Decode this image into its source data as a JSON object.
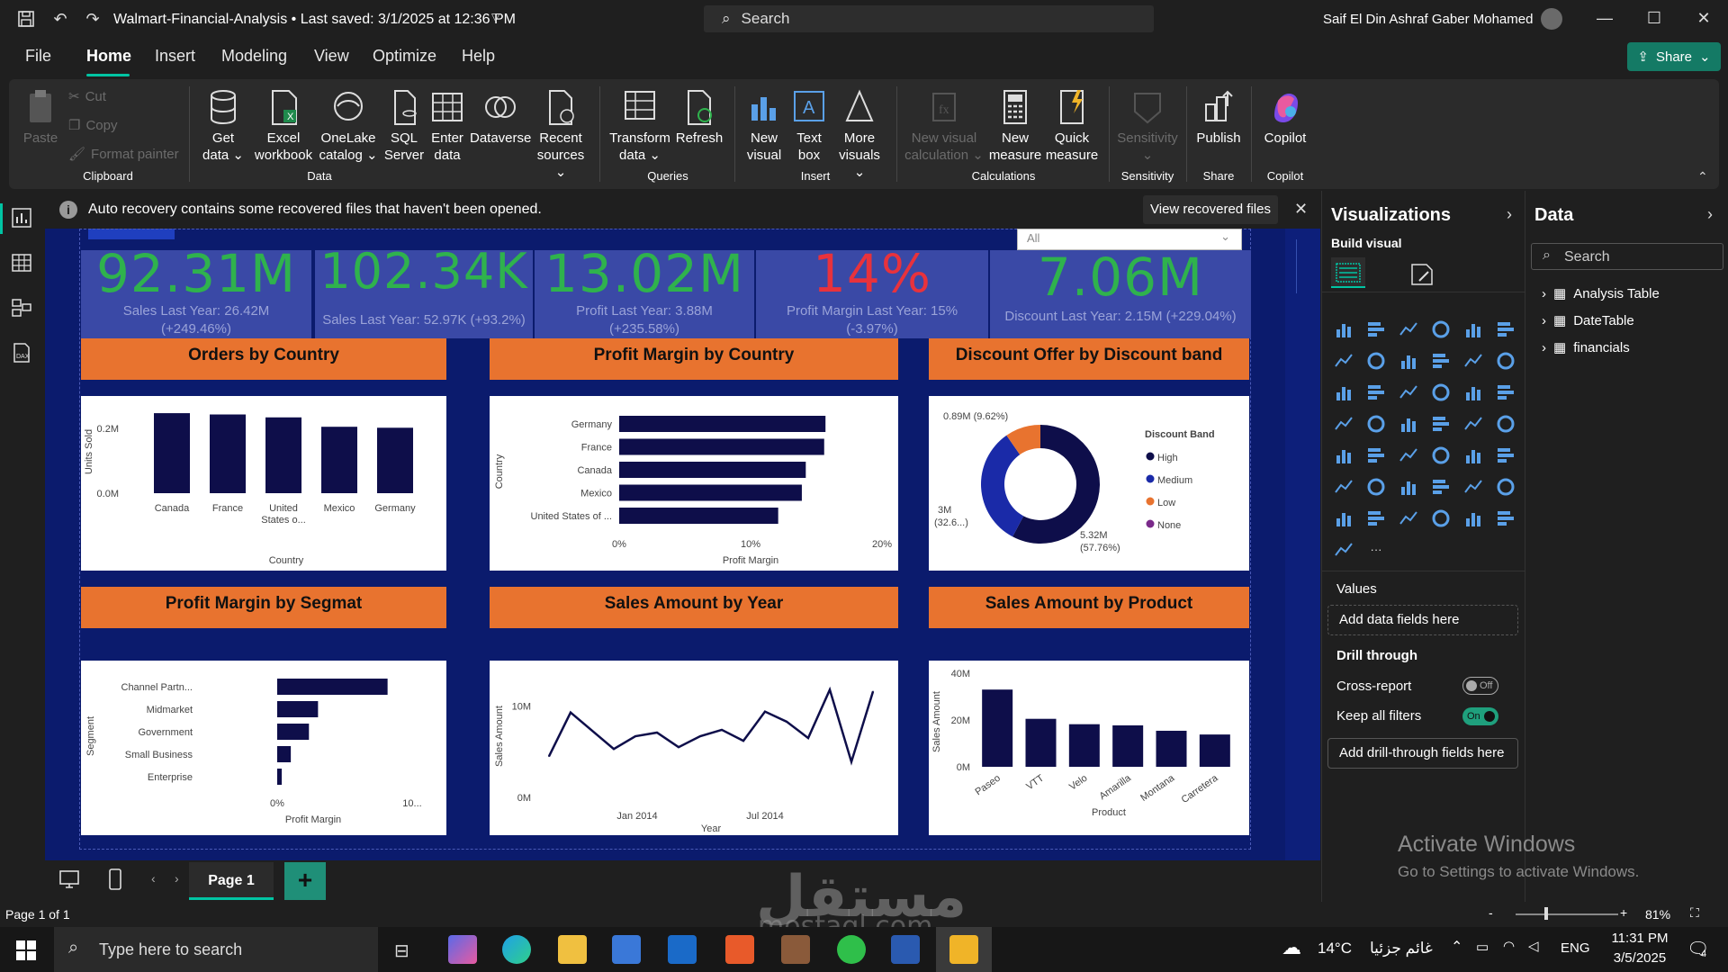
{
  "titlebar": {
    "doc_title": "Walmart-Financial-Analysis • Last saved: 3/1/2025 at 12:36 PM",
    "search_placeholder": "Search",
    "user": "Saif El Din Ashraf Gaber Mohamed"
  },
  "menu": [
    "File",
    "Home",
    "Insert",
    "Modeling",
    "View",
    "Optimize",
    "Help"
  ],
  "share_label": "Share",
  "ribbon": {
    "clipboard": {
      "paste": "Paste",
      "cut": "Cut",
      "copy": "Copy",
      "format_painter": "Format painter",
      "group": "Clipboard"
    },
    "data": {
      "get_data": "Get data",
      "excel": "Excel workbook",
      "onelake": "OneLake catalog",
      "sql": "SQL Server",
      "enter": "Enter data",
      "dataverse": "Dataverse",
      "recent": "Recent sources",
      "group": "Data"
    },
    "queries": {
      "transform": "Transform data",
      "refresh": "Refresh",
      "group": "Queries"
    },
    "insert": {
      "new_visual": "New visual",
      "text_box": "Text box",
      "more_visuals": "More visuals",
      "group": "Insert"
    },
    "calculations": {
      "new_visual_calc": "New visual calculation",
      "new_measure": "New measure",
      "quick_measure": "Quick measure",
      "group": "Calculations"
    },
    "sensitivity": {
      "label": "Sensitivity",
      "group": "Sensitivity"
    },
    "share": {
      "publish": "Publish",
      "group": "Share"
    },
    "copilot": {
      "label": "Copilot",
      "group": "Copilot"
    }
  },
  "infobar": {
    "text": "Auto recovery contains some recovered files that haven't been opened.",
    "button": "View recovered files"
  },
  "slicer": {
    "value": "All"
  },
  "kpis": [
    {
      "value": "92.31M",
      "sub1": "Sales Last Year: 26.42M",
      "sub2": "(+249.46%)",
      "color": "#2fb24d"
    },
    {
      "value": "102.34K",
      "sub1": "Sales Last Year: 52.97K (+93.2%)",
      "sub2": "",
      "color": "#2fb24d"
    },
    {
      "value": "13.02M",
      "sub1": "Profit Last Year: 3.88M",
      "sub2": "(+235.58%)",
      "color": "#2fb24d"
    },
    {
      "value": "14%",
      "sub1": "Profit Margin Last Year: 15%",
      "sub2": "(-3.97%)",
      "color": "#e8323c"
    },
    {
      "value": "7.06M",
      "sub1": "Discount Last Year: 2.15M (+229.04%)",
      "sub2": "",
      "color": "#2fb24d"
    }
  ],
  "headers": [
    "Orders by Country",
    "Profit Margin by Country",
    "Discount Offer by Discount band",
    "Profit Margin by Segmat",
    "Sales Amount by Year",
    "Sales Amount by Product"
  ],
  "chart_data": [
    {
      "type": "bar",
      "title": "Orders by Country",
      "categories": [
        "Canada",
        "France",
        "United States o...",
        "Mexico",
        "Germany"
      ],
      "values": [
        0.247,
        0.243,
        0.234,
        0.205,
        0.202
      ],
      "xlabel": "Country",
      "ylabel": "Units Sold",
      "yticks": [
        "0.0M",
        "0.2M"
      ],
      "ylim": [
        0,
        0.25
      ]
    },
    {
      "type": "bar",
      "orientation": "horizontal",
      "title": "Profit Margin by Country",
      "categories": [
        "Germany",
        "France",
        "Canada",
        "Mexico",
        "United States of ..."
      ],
      "values": [
        0.157,
        0.156,
        0.142,
        0.139,
        0.121
      ],
      "xlabel": "Profit Margin",
      "ylabel": "Country",
      "xticks": [
        "0%",
        "10%",
        "20%"
      ],
      "xlim": [
        0,
        0.2
      ]
    },
    {
      "type": "pie",
      "donut": true,
      "title": "Discount Offer by Discount band",
      "legend_title": "Discount Band",
      "slices": [
        {
          "name": "High",
          "value": 5.32,
          "label": "5.32M",
          "pct": "(57.76%)",
          "color": "#0e0e4a"
        },
        {
          "name": "Medium",
          "value": 3.0,
          "label": "3M",
          "pct": "(32.6...)",
          "color": "#1a2aa8"
        },
        {
          "name": "Low",
          "value": 0.89,
          "label": "0.89M (9.62%)",
          "pct": "",
          "color": "#e8732f"
        },
        {
          "name": "None",
          "value": 0,
          "label": "",
          "pct": "",
          "color": "#7a2a8a"
        }
      ]
    },
    {
      "type": "bar",
      "orientation": "horizontal",
      "title": "Profit Margin by Segmat",
      "categories": [
        "Channel Partn...",
        "Midmarket",
        "Government",
        "Small Business",
        "Enterprise"
      ],
      "values": [
        0.73,
        0.27,
        0.21,
        0.09,
        0.03
      ],
      "xlabel": "Profit Margin",
      "ylabel": "Segment",
      "xticks": [
        "0%",
        "10..."
      ],
      "xlim": [
        0,
        1
      ]
    },
    {
      "type": "line",
      "title": "Sales Amount by Year",
      "x": [
        "2013-09",
        "2013-10",
        "2013-11",
        "2013-12",
        "2014-01",
        "2014-02",
        "2014-03",
        "2014-04",
        "2014-05",
        "2014-06",
        "2014-07",
        "2014-08",
        "2014-09",
        "2014-10",
        "2014-11",
        "2014-12"
      ],
      "values": [
        4.5,
        9.3,
        7.3,
        5.3,
        6.7,
        7.1,
        5.5,
        6.7,
        7.4,
        6.2,
        9.4,
        8.3,
        6.5,
        11.8,
        3.9,
        11.6
      ],
      "xticks": [
        "Jan 2014",
        "Jul 2014"
      ],
      "yticks": [
        "0M",
        "10M"
      ],
      "xlabel": "Year",
      "ylabel": "Sales Amount",
      "ylim": [
        0,
        14
      ]
    },
    {
      "type": "bar",
      "title": "Sales Amount by Product",
      "categories": [
        "Paseo",
        "VTT",
        "Velo",
        "Amarilla",
        "Montana",
        "Carretera"
      ],
      "values": [
        33.0,
        20.5,
        18.2,
        17.7,
        15.4,
        13.8
      ],
      "xlabel": "Product",
      "ylabel": "Sales Amount",
      "yticks": [
        "0M",
        "20M",
        "40M"
      ],
      "ylim": [
        0,
        40
      ]
    }
  ],
  "viz_pane": {
    "title": "Visualizations",
    "build_visual": "Build visual",
    "values_label": "Values",
    "add_data": "Add data fields here",
    "drill_through": "Drill through",
    "cross_report": "Cross-report",
    "cross_state": "Off",
    "keep_filters": "Keep all filters",
    "keep_state": "On",
    "add_drill": "Add drill-through fields here"
  },
  "data_pane": {
    "title": "Data",
    "search_placeholder": "Search",
    "tables": [
      "Analysis Table",
      "DateTable",
      "financials"
    ]
  },
  "pages": {
    "tab": "Page 1",
    "status": "Page 1 of 1",
    "zoom": "81%"
  },
  "watermark": {
    "line1": "Activate Windows",
    "line2": "Go to Settings to activate Windows.",
    "mostaql": "مستقل",
    "mostaql_url": "mostaql.com"
  },
  "taskbar": {
    "search": "Type here to search",
    "weather": "14°C",
    "weather_desc": "غائم جزئيا",
    "lang": "ENG",
    "time": "11:31 PM",
    "date": "3/5/2025",
    "notif": "4"
  }
}
